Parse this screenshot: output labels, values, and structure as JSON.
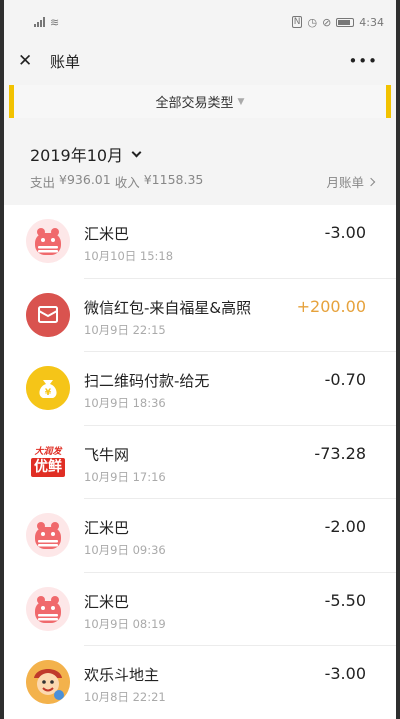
{
  "status_bar": {
    "time": "4:34"
  },
  "nav": {
    "title": "账单"
  },
  "filter": {
    "label": "全部交易类型"
  },
  "month": {
    "selector_label": "2019年10月",
    "expense_label": "支出",
    "expense_amount": "¥936.01",
    "income_label": "收入",
    "income_amount": "¥1158.35",
    "monthly_bill_label": "月账单"
  },
  "transactions": [
    {
      "name": "汇米巴",
      "time": "10月10日 15:18",
      "amount": "-3.00",
      "icon": "piggy-bank-icon"
    },
    {
      "name": "微信红包-来自福星&高照",
      "time": "10月9日 22:15",
      "amount": "+200.00",
      "icon": "red-packet-icon"
    },
    {
      "name": "扫二维码付款-给无",
      "time": "10月9日 18:36",
      "amount": "-0.70",
      "icon": "money-bag-icon"
    },
    {
      "name": "飞牛网",
      "time": "10月9日 17:16",
      "amount": "-73.28",
      "icon": "feiniu-logo-icon",
      "logo_top": "大润发",
      "logo_bottom": "优鲜"
    },
    {
      "name": "汇米巴",
      "time": "10月9日 09:36",
      "amount": "-2.00",
      "icon": "piggy-bank-icon"
    },
    {
      "name": "汇米巴",
      "time": "10月9日 08:19",
      "amount": "-5.50",
      "icon": "piggy-bank-icon"
    },
    {
      "name": "欢乐斗地主",
      "time": "10月8日 22:21",
      "amount": "-3.00",
      "icon": "game-avatar-icon"
    }
  ],
  "colors": {
    "accent_yellow": "#f2c200",
    "income_orange": "#e6a23c",
    "piggy_red": "#f0696c",
    "packet_red": "#d9534f",
    "bag_yellow": "#f5c518"
  }
}
